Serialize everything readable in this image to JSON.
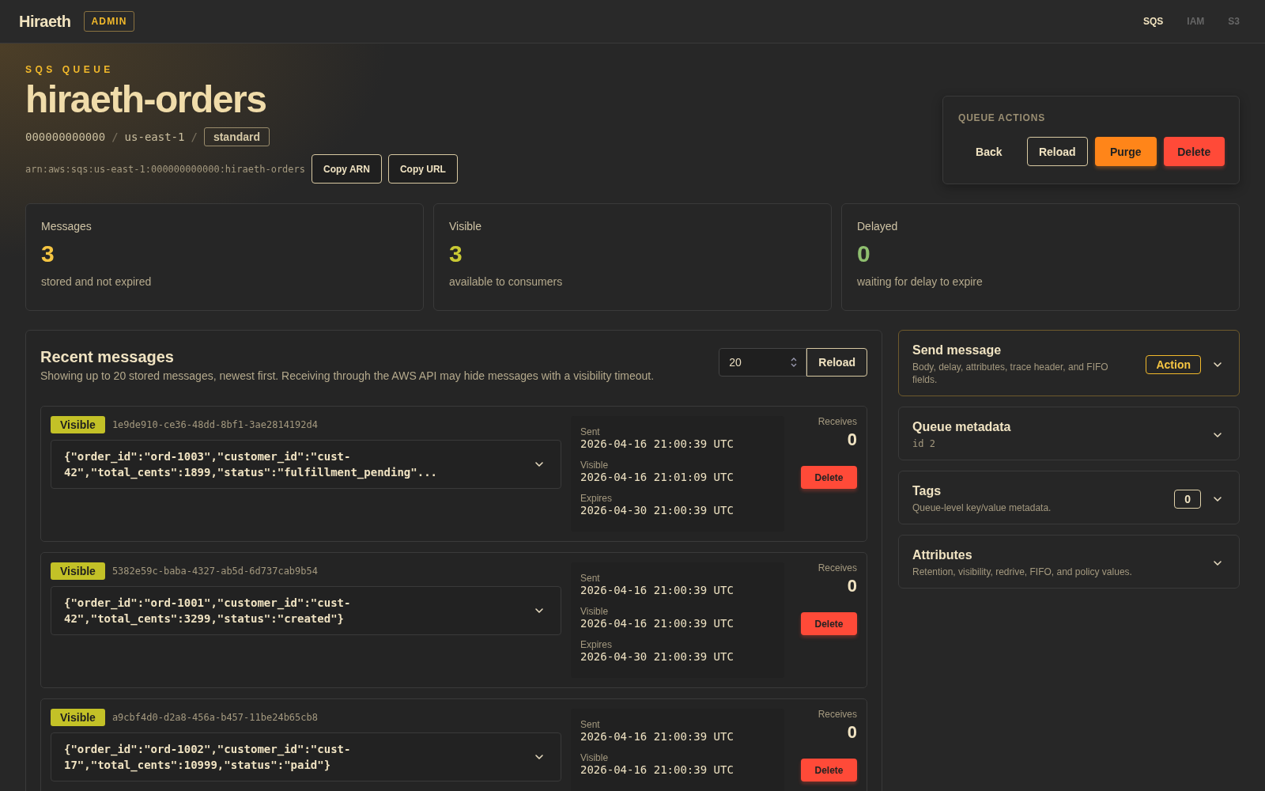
{
  "header": {
    "logo": "Hiraeth",
    "badge": "ADMIN",
    "nav": [
      {
        "label": "SQS",
        "selected": true
      },
      {
        "label": "IAM",
        "selected": false
      },
      {
        "label": "S3",
        "selected": false
      }
    ]
  },
  "queue": {
    "eyebrow": "SQS QUEUE",
    "name": "hiraeth-orders",
    "account": "000000000000",
    "region": "us-east-1",
    "type": "standard",
    "separator": "/",
    "arn": "arn:aws:sqs:us-east-1:000000000000:hiraeth-orders",
    "buttons": [
      "Copy ARN",
      "Copy URL"
    ]
  },
  "actions": {
    "title": "QUEUE ACTIONS",
    "buttons": [
      {
        "label": "Back",
        "kind": "plain"
      },
      {
        "label": "Reload",
        "kind": "outline"
      },
      {
        "label": "Purge",
        "kind": "warning"
      },
      {
        "label": "Delete",
        "kind": "danger"
      }
    ]
  },
  "stats": [
    {
      "label": "Messages",
      "value": "3",
      "caption": "stored and not expired",
      "color": "#f5c542"
    },
    {
      "label": "Visible",
      "value": "3",
      "caption": "available to consumers",
      "color": "#c9c934"
    },
    {
      "label": "Delayed",
      "value": "0",
      "caption": "waiting for delay to expire",
      "color": "#8fbf6f"
    }
  ],
  "recent": {
    "title": "Recent messages",
    "subtitle": "Showing up to 20 stored messages, newest first. Receiving through the AWS API may hide messages with a visibility timeout.",
    "limit": "20",
    "reload": "Reload",
    "messages": [
      {
        "status": "Visible",
        "id": "1e9de910-ce36-48dd-8bf1-3ae2814192d4",
        "body": "{\"order_id\":\"ord-1003\",\"customer_id\":\"cust-42\",\"total_cents\":1899,\"status\":\"fulfillment_pending\"...",
        "times": [
          {
            "label": "Sent",
            "value": "2026-04-16 21:00:39 UTC"
          },
          {
            "label": "Visible",
            "value": "2026-04-16 21:01:09 UTC"
          },
          {
            "label": "Expires",
            "value": "2026-04-30 21:00:39 UTC"
          }
        ],
        "receives_label": "Receives",
        "receives": "0",
        "delete": "Delete"
      },
      {
        "status": "Visible",
        "id": "5382e59c-baba-4327-ab5d-6d737cab9b54",
        "body": "{\"order_id\":\"ord-1001\",\"customer_id\":\"cust-42\",\"total_cents\":3299,\"status\":\"created\"}",
        "times": [
          {
            "label": "Sent",
            "value": "2026-04-16 21:00:39 UTC"
          },
          {
            "label": "Visible",
            "value": "2026-04-16 21:00:39 UTC"
          },
          {
            "label": "Expires",
            "value": "2026-04-30 21:00:39 UTC"
          }
        ],
        "receives_label": "Receives",
        "receives": "0",
        "delete": "Delete"
      },
      {
        "status": "Visible",
        "id": "a9cbf4d0-d2a8-456a-b457-11be24b65cb8",
        "body": "{\"order_id\":\"ord-1002\",\"customer_id\":\"cust-17\",\"total_cents\":10999,\"status\":\"paid\"}",
        "times": [
          {
            "label": "Sent",
            "value": "2026-04-16 21:00:39 UTC"
          },
          {
            "label": "Visible",
            "value": "2026-04-16 21:00:39 UTC"
          }
        ],
        "receives_label": "Receives",
        "receives": "0",
        "delete": "Delete"
      }
    ]
  },
  "panels": [
    {
      "title": "Send message",
      "description": "Body, delay, attributes, trace header, and FIFO fields.",
      "badge": "Action",
      "kind": "action",
      "highlighted": true
    },
    {
      "title": "Queue metadata",
      "description": "id 2",
      "kind": "mono",
      "highlighted": false
    },
    {
      "title": "Tags",
      "description": "Queue-level key/value metadata.",
      "badge": "0",
      "kind": "count",
      "highlighted": false
    },
    {
      "title": "Attributes",
      "description": "Retention, visibility, redrive, FIFO, and policy values.",
      "kind": "text",
      "highlighted": false
    }
  ]
}
